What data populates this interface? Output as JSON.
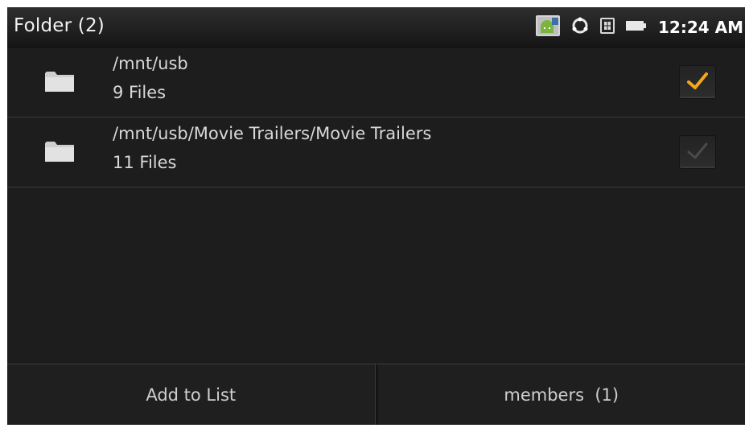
{
  "titlebar": {
    "title": "Folder (2)",
    "clock": "12:24 AM",
    "status_icons": [
      "android-notification-icon",
      "sync-icon",
      "sim-card-icon",
      "battery-icon"
    ]
  },
  "folders": [
    {
      "path": "/mnt/usb",
      "count": "9 Files",
      "checked": true
    },
    {
      "path": "/mnt/usb/Movie Trailers/Movie Trailers",
      "count": "11 Files",
      "checked": false
    }
  ],
  "buttons": {
    "add_to_list": "Add to List",
    "members": "members  (1)"
  },
  "colors": {
    "background": "#1d1d1d",
    "check_active": "#f4a81a",
    "check_inactive": "#4a4a4a"
  }
}
